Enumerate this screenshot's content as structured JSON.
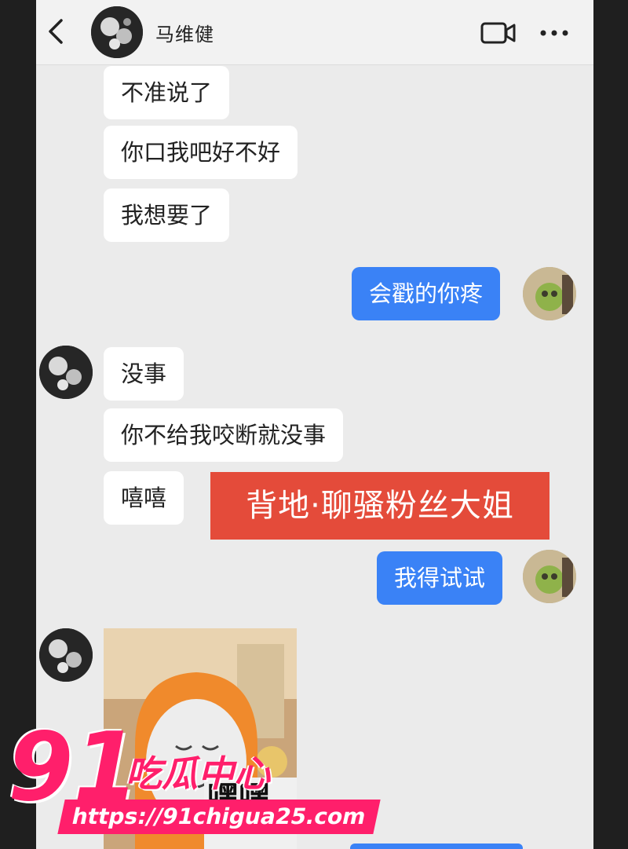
{
  "header": {
    "contact_name": "马维健",
    "back_icon": "chevron-left-icon",
    "video_icon": "video-camera-icon",
    "more_icon": "more-dots-icon"
  },
  "messages": [
    {
      "from": "contact",
      "text": "不准说了"
    },
    {
      "from": "contact",
      "text": "你口我吧好不好"
    },
    {
      "from": "contact",
      "text": "我想要了"
    },
    {
      "from": "me",
      "text": "会戳的你疼"
    },
    {
      "from": "contact",
      "text": "没事"
    },
    {
      "from": "contact",
      "text": "你不给我咬断就没事"
    },
    {
      "from": "contact",
      "text": "嘻嘻"
    },
    {
      "from": "me",
      "text": "我得试试"
    },
    {
      "from": "contact",
      "type": "sticker",
      "caption": "嘿嘿"
    }
  ],
  "overlay_banner": "背地·聊骚粉丝大姐",
  "watermark": {
    "number": "91",
    "brand": "吃瓜中心",
    "url": "https://91chigua25.com"
  },
  "colors": {
    "outgoing_bubble": "#3a82f6",
    "incoming_bubble": "#ffffff",
    "chat_background": "#ebebeb",
    "banner": "#e44b3a",
    "watermark": "#ff1f6b"
  }
}
